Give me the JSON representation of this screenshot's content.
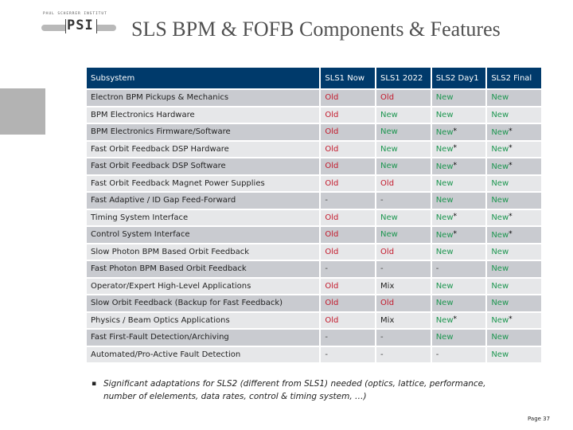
{
  "logo": {
    "top_text": "PAUL SCHERRER INSTITUT",
    "mark": "PSI"
  },
  "title": "SLS BPM & FOFB Components & Features",
  "colors": {
    "header_bg": "#003a6b",
    "row_dark": "#c9cbd0",
    "row_light": "#e6e7e9",
    "old": "#c3182a",
    "new": "#1d9650"
  },
  "table": {
    "headers": [
      "Subsystem",
      "SLS1 Now",
      "SLS1 2022",
      "SLS2 Day1",
      "SLS2 Final"
    ],
    "rows": [
      {
        "subsystem": "Electron BPM Pickups & Mechanics",
        "cells": [
          "Old",
          "Old",
          "New",
          "New"
        ]
      },
      {
        "subsystem": "BPM Electronics Hardware",
        "cells": [
          "Old",
          "New",
          "New",
          "New"
        ]
      },
      {
        "subsystem": "BPM Electronics Firmware/Software",
        "cells": [
          "Old",
          "New",
          "New*",
          "New*"
        ]
      },
      {
        "subsystem": "Fast Orbit Feedback DSP Hardware",
        "cells": [
          "Old",
          "New",
          "New*",
          "New*"
        ]
      },
      {
        "subsystem": "Fast Orbit Feedback DSP Software",
        "cells": [
          "Old",
          "New",
          "New*",
          "New*"
        ]
      },
      {
        "subsystem": "Fast Orbit Feedback Magnet Power Supplies",
        "cells": [
          "Old",
          "Old",
          "New",
          "New"
        ]
      },
      {
        "subsystem": "Fast Adaptive / ID Gap Feed-Forward",
        "cells": [
          "-",
          "-",
          "New",
          "New"
        ]
      },
      {
        "subsystem": "Timing System Interface",
        "cells": [
          "Old",
          "New",
          "New*",
          "New*"
        ]
      },
      {
        "subsystem": "Control System Interface",
        "cells": [
          "Old",
          "New",
          "New*",
          "New*"
        ]
      },
      {
        "subsystem": "Slow Photon BPM Based Orbit Feedback",
        "cells": [
          "Old",
          "Old",
          "New",
          "New"
        ]
      },
      {
        "subsystem": "Fast Photon BPM Based Orbit Feedback",
        "cells": [
          "-",
          "-",
          "-",
          "New"
        ]
      },
      {
        "subsystem": "Operator/Expert High-Level Applications",
        "cells": [
          "Old",
          "Mix",
          "New",
          "New"
        ]
      },
      {
        "subsystem": "Slow Orbit Feedback (Backup for Fast Feedback)",
        "cells": [
          "Old",
          "Old",
          "New",
          "New"
        ]
      },
      {
        "subsystem": "Physics / Beam Optics Applications",
        "cells": [
          "Old",
          "Mix",
          "New*",
          "New*"
        ]
      },
      {
        "subsystem": "Fast First-Fault Detection/Archiving",
        "cells": [
          "-",
          "-",
          "New",
          "New"
        ]
      },
      {
        "subsystem": "Automated/Pro-Active Fault Detection",
        "cells": [
          "-",
          "-",
          "-",
          "New"
        ]
      }
    ]
  },
  "footnote": {
    "bullet": "▪",
    "text": "Significant adaptations for SLS2 (different from SLS1) needed (optics, lattice, performance, number of elelements, data rates, control & timing system, …)"
  },
  "page": "Page 37"
}
